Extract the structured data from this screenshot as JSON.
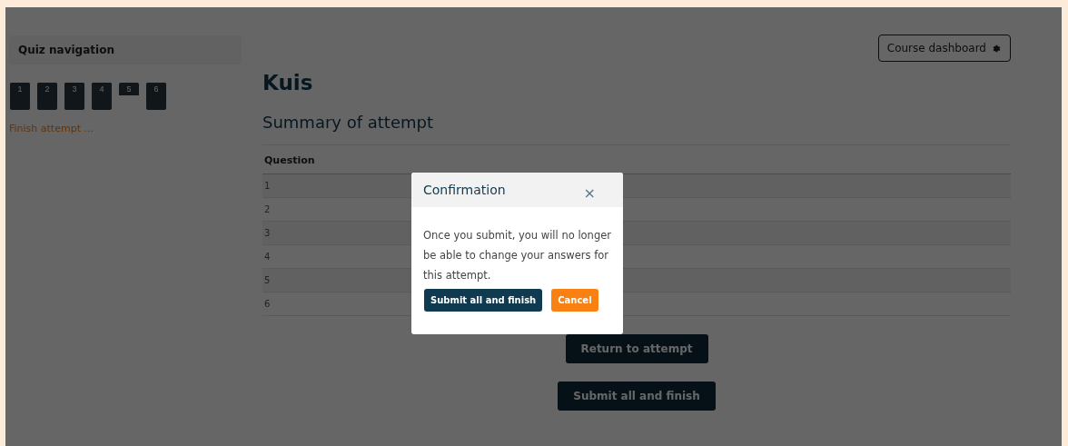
{
  "sidebar": {
    "title": "Quiz navigation",
    "questions": [
      {
        "label": "1",
        "answered": true
      },
      {
        "label": "2",
        "answered": true
      },
      {
        "label": "3",
        "answered": true
      },
      {
        "label": "4",
        "answered": true
      },
      {
        "label": "5",
        "answered": false
      },
      {
        "label": "6",
        "answered": true
      }
    ],
    "finish_link": "Finish attempt ..."
  },
  "header_button": "Course dashboard",
  "title": "Kuis",
  "subtitle": "Summary of attempt",
  "table": {
    "columns": [
      "Question"
    ],
    "rows": [
      "1",
      "2",
      "3",
      "4",
      "5",
      "6"
    ]
  },
  "actions": [
    "Return to attempt",
    "Submit all and finish"
  ],
  "dialog": {
    "title": "Confirmation",
    "close": "×",
    "message": "Once you submit, you will no longer be able to change your answers for this attempt.",
    "buttons": [
      {
        "label": "Submit all and finish",
        "kind": "primary"
      },
      {
        "label": "Cancel",
        "kind": "secondary"
      }
    ]
  }
}
